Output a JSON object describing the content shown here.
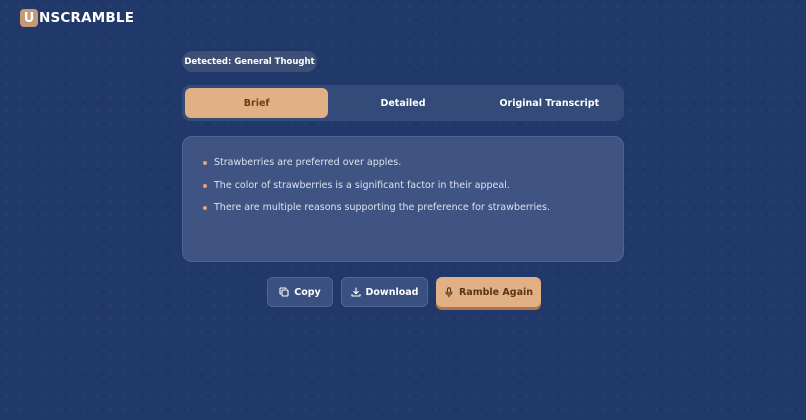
{
  "app": {
    "logo_letter": "U",
    "logo_rest": "NSCRAMBLE"
  },
  "detected": {
    "label": "Detected: General Thought"
  },
  "tabs": [
    {
      "label": "Brief",
      "active": true
    },
    {
      "label": "Detailed",
      "active": false
    },
    {
      "label": "Original Transcript",
      "active": false
    }
  ],
  "summary": {
    "bullets": [
      "Strawberries are preferred over apples.",
      "The color of strawberries is a significant factor in their appeal.",
      "There are multiple reasons supporting the preference for strawberries."
    ]
  },
  "actions": {
    "copy_label": "Copy",
    "download_label": "Download",
    "ramble_label": "Ramble Again"
  },
  "icons": {
    "copy": "copy-icon",
    "download": "download-icon",
    "ramble": "microphone-icon"
  },
  "colors": {
    "background": "#21396a",
    "accent": "#e1b185",
    "accent_text": "#6b3c15",
    "bullet": "#e0a46c",
    "card": "#3f5482",
    "tabs_bg": "#344a78"
  }
}
